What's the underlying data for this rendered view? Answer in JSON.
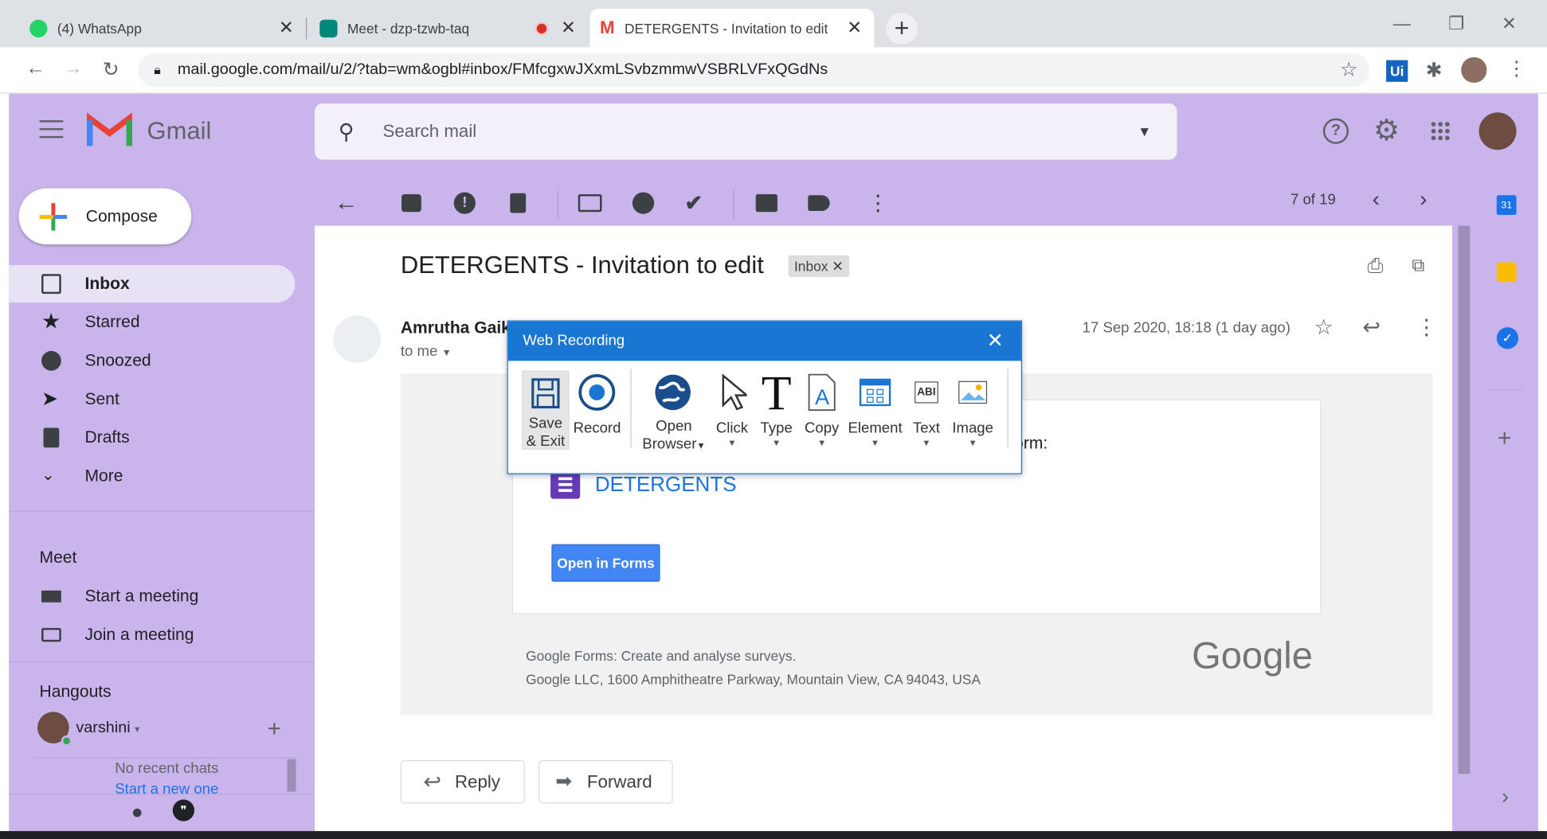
{
  "browser": {
    "tabs": [
      {
        "title": "(4) WhatsApp",
        "icon": "whatsapp-icon"
      },
      {
        "title": "Meet - dzp-tzwb-taq",
        "icon": "meet-icon",
        "recording": true
      },
      {
        "title": "DETERGENTS - Invitation to edit",
        "icon": "gmail-icon",
        "active": true
      }
    ],
    "url": "mail.google.com/mail/u/2/?tab=wm&ogbl#inbox/FMfcgxwJXxmLSvbzmmwVSBRLVFxQGdNs",
    "extension_label": "Ui"
  },
  "gmail": {
    "logo_text": "Gmail",
    "search_placeholder": "Search mail",
    "compose_label": "Compose",
    "nav": [
      {
        "label": "Inbox",
        "icon": "inbox-icon",
        "selected": true
      },
      {
        "label": "Starred",
        "icon": "star-icon"
      },
      {
        "label": "Snoozed",
        "icon": "clock-icon"
      },
      {
        "label": "Sent",
        "icon": "send-icon"
      },
      {
        "label": "Drafts",
        "icon": "draft-icon"
      },
      {
        "label": "More",
        "icon": "chevron-down-icon"
      }
    ],
    "meet": {
      "title": "Meet",
      "start": "Start a meeting",
      "join": "Join a meeting"
    },
    "hangouts": {
      "title": "Hangouts",
      "user": "varshini",
      "no_chats": "No recent chats",
      "start_new": "Start a new one"
    },
    "pager": "7 of 19",
    "email": {
      "subject": "DETERGENTS - Invitation to edit",
      "label": "Inbox",
      "sender": "Amrutha Gaik",
      "to": "to me",
      "date": "17 Sep 2020, 18:18 (1 day ago)",
      "body_fragment": "orm:",
      "form_name": "DETERGENTS",
      "open_button": "Open in Forms",
      "footer_line1": "Google Forms: Create and analyse surveys.",
      "footer_line2": "Google LLC, 1600 Amphitheatre Parkway, Mountain View, CA 94043, USA",
      "google_logo": "Google"
    },
    "reply_label": "Reply",
    "forward_label": "Forward"
  },
  "dialog": {
    "title": "Web Recording",
    "tools": [
      {
        "label": "Save\n& Exit",
        "icon": "save-icon"
      },
      {
        "label": "Record",
        "icon": "record-icon"
      },
      {
        "label": "Open\nBrowser",
        "icon": "globe-icon"
      },
      {
        "label": "Click",
        "icon": "cursor-icon"
      },
      {
        "label": "Type",
        "icon": "type-icon"
      },
      {
        "label": "Copy",
        "icon": "copy-icon"
      },
      {
        "label": "Element",
        "icon": "element-icon"
      },
      {
        "label": "Text",
        "icon": "text-icon"
      },
      {
        "label": "Image",
        "icon": "image-icon"
      }
    ],
    "text_icon_glyph": "ABI"
  },
  "colors": {
    "gmail_bg": "#c9b5ec",
    "dialog_blue": "#1976d2",
    "link_blue": "#1a73e8",
    "forms_purple": "#673ab7"
  }
}
